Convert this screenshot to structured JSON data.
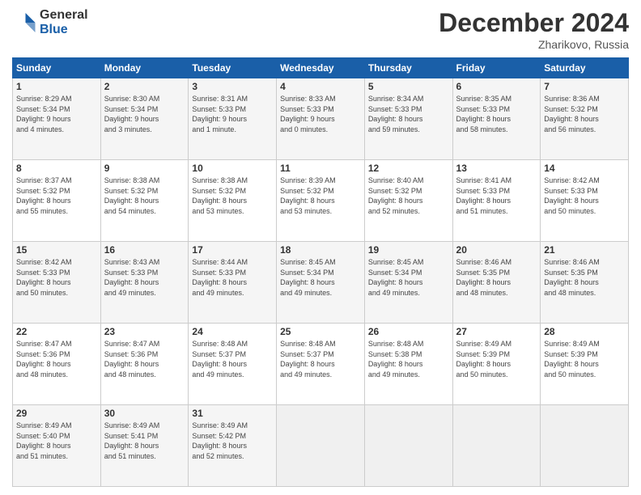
{
  "header": {
    "logo_general": "General",
    "logo_blue": "Blue",
    "month_title": "December 2024",
    "subtitle": "Zharikovo, Russia"
  },
  "weekdays": [
    "Sunday",
    "Monday",
    "Tuesday",
    "Wednesday",
    "Thursday",
    "Friday",
    "Saturday"
  ],
  "weeks": [
    [
      {
        "day": "1",
        "lines": [
          "Sunrise: 8:29 AM",
          "Sunset: 5:34 PM",
          "Daylight: 9 hours",
          "and 4 minutes."
        ]
      },
      {
        "day": "2",
        "lines": [
          "Sunrise: 8:30 AM",
          "Sunset: 5:34 PM",
          "Daylight: 9 hours",
          "and 3 minutes."
        ]
      },
      {
        "day": "3",
        "lines": [
          "Sunrise: 8:31 AM",
          "Sunset: 5:33 PM",
          "Daylight: 9 hours",
          "and 1 minute."
        ]
      },
      {
        "day": "4",
        "lines": [
          "Sunrise: 8:33 AM",
          "Sunset: 5:33 PM",
          "Daylight: 9 hours",
          "and 0 minutes."
        ]
      },
      {
        "day": "5",
        "lines": [
          "Sunrise: 8:34 AM",
          "Sunset: 5:33 PM",
          "Daylight: 8 hours",
          "and 59 minutes."
        ]
      },
      {
        "day": "6",
        "lines": [
          "Sunrise: 8:35 AM",
          "Sunset: 5:33 PM",
          "Daylight: 8 hours",
          "and 58 minutes."
        ]
      },
      {
        "day": "7",
        "lines": [
          "Sunrise: 8:36 AM",
          "Sunset: 5:32 PM",
          "Daylight: 8 hours",
          "and 56 minutes."
        ]
      }
    ],
    [
      {
        "day": "8",
        "lines": [
          "Sunrise: 8:37 AM",
          "Sunset: 5:32 PM",
          "Daylight: 8 hours",
          "and 55 minutes."
        ]
      },
      {
        "day": "9",
        "lines": [
          "Sunrise: 8:38 AM",
          "Sunset: 5:32 PM",
          "Daylight: 8 hours",
          "and 54 minutes."
        ]
      },
      {
        "day": "10",
        "lines": [
          "Sunrise: 8:38 AM",
          "Sunset: 5:32 PM",
          "Daylight: 8 hours",
          "and 53 minutes."
        ]
      },
      {
        "day": "11",
        "lines": [
          "Sunrise: 8:39 AM",
          "Sunset: 5:32 PM",
          "Daylight: 8 hours",
          "and 53 minutes."
        ]
      },
      {
        "day": "12",
        "lines": [
          "Sunrise: 8:40 AM",
          "Sunset: 5:32 PM",
          "Daylight: 8 hours",
          "and 52 minutes."
        ]
      },
      {
        "day": "13",
        "lines": [
          "Sunrise: 8:41 AM",
          "Sunset: 5:33 PM",
          "Daylight: 8 hours",
          "and 51 minutes."
        ]
      },
      {
        "day": "14",
        "lines": [
          "Sunrise: 8:42 AM",
          "Sunset: 5:33 PM",
          "Daylight: 8 hours",
          "and 50 minutes."
        ]
      }
    ],
    [
      {
        "day": "15",
        "lines": [
          "Sunrise: 8:42 AM",
          "Sunset: 5:33 PM",
          "Daylight: 8 hours",
          "and 50 minutes."
        ]
      },
      {
        "day": "16",
        "lines": [
          "Sunrise: 8:43 AM",
          "Sunset: 5:33 PM",
          "Daylight: 8 hours",
          "and 49 minutes."
        ]
      },
      {
        "day": "17",
        "lines": [
          "Sunrise: 8:44 AM",
          "Sunset: 5:33 PM",
          "Daylight: 8 hours",
          "and 49 minutes."
        ]
      },
      {
        "day": "18",
        "lines": [
          "Sunrise: 8:45 AM",
          "Sunset: 5:34 PM",
          "Daylight: 8 hours",
          "and 49 minutes."
        ]
      },
      {
        "day": "19",
        "lines": [
          "Sunrise: 8:45 AM",
          "Sunset: 5:34 PM",
          "Daylight: 8 hours",
          "and 49 minutes."
        ]
      },
      {
        "day": "20",
        "lines": [
          "Sunrise: 8:46 AM",
          "Sunset: 5:35 PM",
          "Daylight: 8 hours",
          "and 48 minutes."
        ]
      },
      {
        "day": "21",
        "lines": [
          "Sunrise: 8:46 AM",
          "Sunset: 5:35 PM",
          "Daylight: 8 hours",
          "and 48 minutes."
        ]
      }
    ],
    [
      {
        "day": "22",
        "lines": [
          "Sunrise: 8:47 AM",
          "Sunset: 5:36 PM",
          "Daylight: 8 hours",
          "and 48 minutes."
        ]
      },
      {
        "day": "23",
        "lines": [
          "Sunrise: 8:47 AM",
          "Sunset: 5:36 PM",
          "Daylight: 8 hours",
          "and 48 minutes."
        ]
      },
      {
        "day": "24",
        "lines": [
          "Sunrise: 8:48 AM",
          "Sunset: 5:37 PM",
          "Daylight: 8 hours",
          "and 49 minutes."
        ]
      },
      {
        "day": "25",
        "lines": [
          "Sunrise: 8:48 AM",
          "Sunset: 5:37 PM",
          "Daylight: 8 hours",
          "and 49 minutes."
        ]
      },
      {
        "day": "26",
        "lines": [
          "Sunrise: 8:48 AM",
          "Sunset: 5:38 PM",
          "Daylight: 8 hours",
          "and 49 minutes."
        ]
      },
      {
        "day": "27",
        "lines": [
          "Sunrise: 8:49 AM",
          "Sunset: 5:39 PM",
          "Daylight: 8 hours",
          "and 50 minutes."
        ]
      },
      {
        "day": "28",
        "lines": [
          "Sunrise: 8:49 AM",
          "Sunset: 5:39 PM",
          "Daylight: 8 hours",
          "and 50 minutes."
        ]
      }
    ],
    [
      {
        "day": "29",
        "lines": [
          "Sunrise: 8:49 AM",
          "Sunset: 5:40 PM",
          "Daylight: 8 hours",
          "and 51 minutes."
        ]
      },
      {
        "day": "30",
        "lines": [
          "Sunrise: 8:49 AM",
          "Sunset: 5:41 PM",
          "Daylight: 8 hours",
          "and 51 minutes."
        ]
      },
      {
        "day": "31",
        "lines": [
          "Sunrise: 8:49 AM",
          "Sunset: 5:42 PM",
          "Daylight: 8 hours",
          "and 52 minutes."
        ]
      },
      null,
      null,
      null,
      null
    ]
  ]
}
